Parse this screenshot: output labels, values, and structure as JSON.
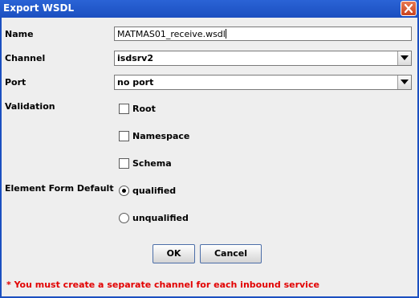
{
  "window": {
    "title": "Export WSDL"
  },
  "form": {
    "name_label": "Name",
    "name_value": "MATMAS01_receive.wsdl",
    "channel_label": "Channel",
    "channel_value": "isdsrv2",
    "port_label": "Port",
    "port_value": "no port",
    "validation_label": "Validation",
    "validation_options": [
      {
        "label": "Root",
        "checked": false
      },
      {
        "label": "Namespace",
        "checked": false
      },
      {
        "label": "Schema",
        "checked": false
      }
    ],
    "element_form_default_label": "Element Form Default",
    "element_form_default_options": [
      {
        "label": "qualified",
        "selected": true
      },
      {
        "label": "unqualified",
        "selected": false
      }
    ]
  },
  "buttons": {
    "ok_label": "OK",
    "cancel_label": "Cancel"
  },
  "note": "* You must create a separate channel for each inbound service",
  "colors": {
    "titlebar": "#1f57c8",
    "note": "#e20000"
  }
}
